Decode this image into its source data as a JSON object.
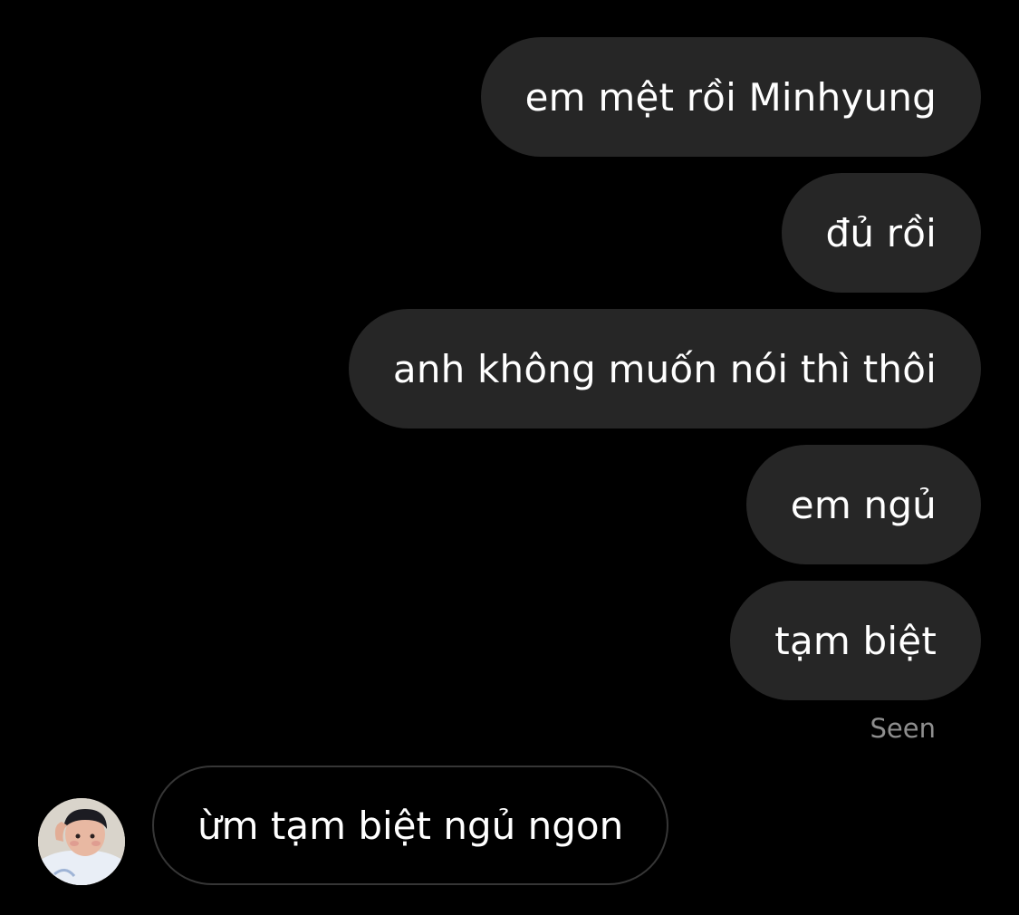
{
  "conversation": {
    "messages_out": [
      {
        "text": "em mệt rồi Minhyung"
      },
      {
        "text": "đủ rồi"
      },
      {
        "text": "anh không muốn nói thì thôi"
      },
      {
        "text": "em ngủ"
      },
      {
        "text": "tạm biệt"
      }
    ],
    "seen_label": "Seen",
    "message_in": {
      "text": "ừm tạm biệt ngủ ngon"
    }
  },
  "colors": {
    "background": "#000000",
    "outgoing_bubble": "#262626",
    "incoming_border": "#363636",
    "seen_text": "#8e8e8e"
  }
}
